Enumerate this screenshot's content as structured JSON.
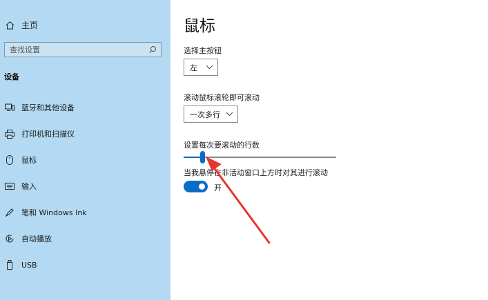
{
  "sidebar": {
    "home_label": "主页",
    "search_placeholder": "查找设置",
    "section_title": "设备",
    "items": [
      {
        "label": "蓝牙和其他设备",
        "icon": "bluetooth-devices-icon"
      },
      {
        "label": "打印机和扫描仪",
        "icon": "printer-icon"
      },
      {
        "label": "鼠标",
        "icon": "mouse-icon"
      },
      {
        "label": "输入",
        "icon": "keyboard-icon"
      },
      {
        "label": "笔和 Windows Ink",
        "icon": "pen-icon"
      },
      {
        "label": "自动播放",
        "icon": "autoplay-icon"
      },
      {
        "label": "USB",
        "icon": "usb-icon"
      }
    ]
  },
  "main": {
    "title": "鼠标",
    "primary_button": {
      "label": "选择主按钮",
      "value": "左"
    },
    "scroll_mode": {
      "label": "滚动鼠标滚轮即可滚动",
      "value": "一次多行"
    },
    "scroll_lines": {
      "label": "设置每次要滚动的行数",
      "level_fraction": 0.12
    },
    "inactive_scroll": {
      "label": "当我悬停在非活动窗口上方时对其进行滚动",
      "state": "开"
    }
  },
  "colors": {
    "sidebar_bg": "#b3daf2",
    "accent": "#0a6cc7",
    "annotation_arrow": "#e8342f"
  }
}
